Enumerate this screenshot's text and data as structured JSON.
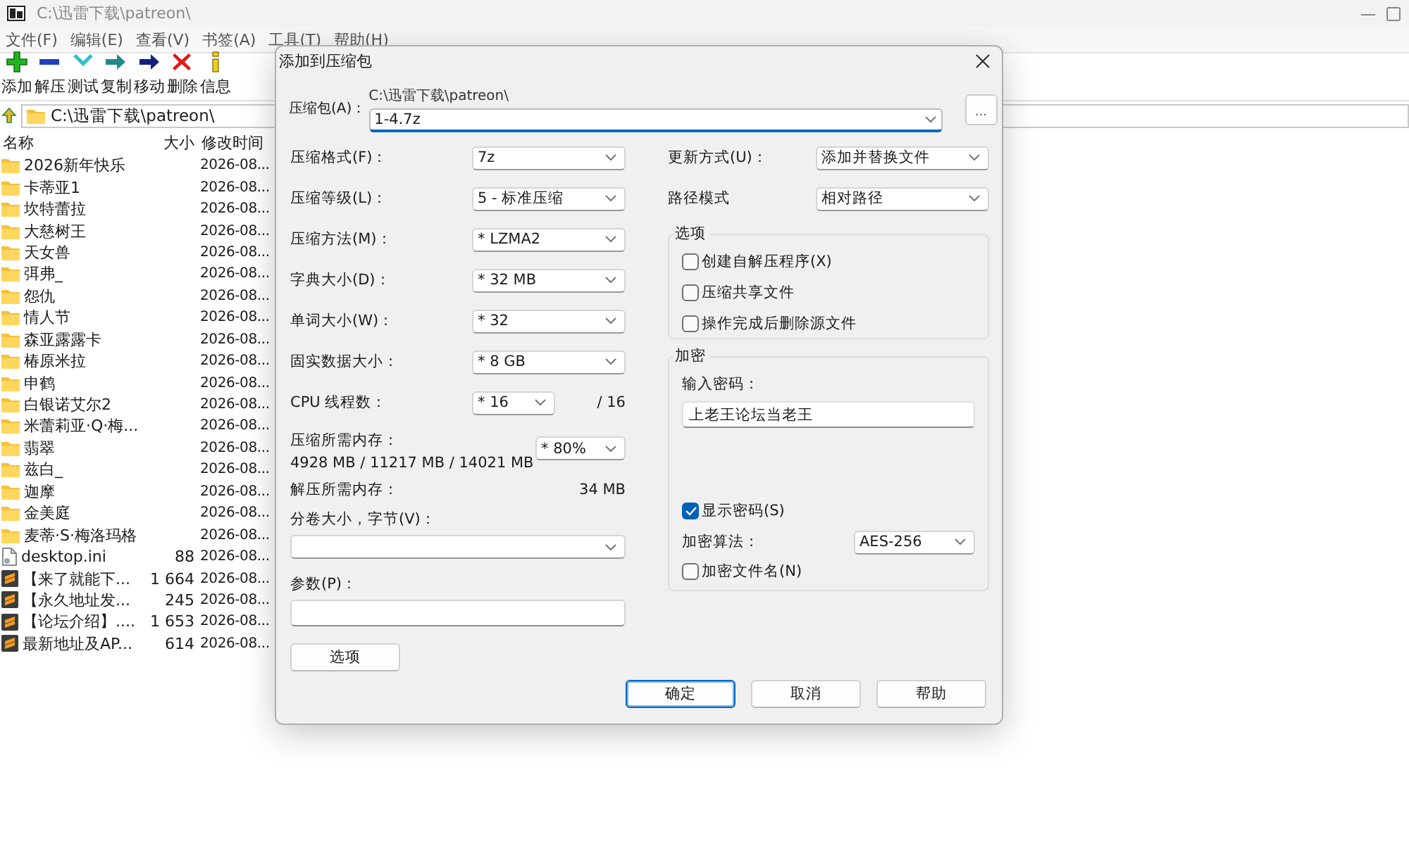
{
  "window": {
    "title": "C:\\迅雷下载\\patreon\\"
  },
  "menu": [
    {
      "label": "文件(F)"
    },
    {
      "label": "编辑(E)"
    },
    {
      "label": "查看(V)"
    },
    {
      "label": "书签(A)"
    },
    {
      "label": "工具(T)"
    },
    {
      "label": "帮助(H)"
    }
  ],
  "toolbar": [
    {
      "label": "添加",
      "kind": "add"
    },
    {
      "label": "解压",
      "kind": "extract"
    },
    {
      "label": "测试",
      "kind": "test"
    },
    {
      "label": "复制",
      "kind": "copy"
    },
    {
      "label": "移动",
      "kind": "move"
    },
    {
      "label": "删除",
      "kind": "delete"
    },
    {
      "label": "信息",
      "kind": "info"
    }
  ],
  "address": {
    "path": "C:\\迅雷下载\\patreon\\"
  },
  "file_list": {
    "columns": [
      "名称",
      "大小",
      "修改时间"
    ],
    "rows": [
      {
        "name": "2026新年快乐",
        "modified": "2026-08...",
        "kind": "folder"
      },
      {
        "name": "卡蒂亚1",
        "modified": "2026-08...",
        "kind": "folder"
      },
      {
        "name": "坎特蕾拉",
        "modified": "2026-08...",
        "kind": "folder"
      },
      {
        "name": "大慈树王",
        "modified": "2026-08...",
        "kind": "folder"
      },
      {
        "name": "天女兽",
        "modified": "2026-08...",
        "kind": "folder"
      },
      {
        "name": "弭弗_",
        "modified": "2026-08...",
        "kind": "folder"
      },
      {
        "name": "怨仇",
        "modified": "2026-08...",
        "kind": "folder"
      },
      {
        "name": "情人节",
        "modified": "2026-08...",
        "kind": "folder"
      },
      {
        "name": "森亚露露卡",
        "modified": "2026-08...",
        "kind": "folder"
      },
      {
        "name": "椿原米拉",
        "modified": "2026-08...",
        "kind": "folder"
      },
      {
        "name": "申鹤",
        "modified": "2026-08...",
        "kind": "folder"
      },
      {
        "name": "白银诺艾尔2",
        "modified": "2026-08...",
        "kind": "folder"
      },
      {
        "name": "米蕾莉亚·Q·梅...",
        "modified": "2026-08...",
        "kind": "folder"
      },
      {
        "name": "翡翠",
        "modified": "2026-08...",
        "kind": "folder"
      },
      {
        "name": "兹白_",
        "modified": "2026-08...",
        "kind": "folder"
      },
      {
        "name": "迦摩",
        "modified": "2026-08...",
        "kind": "folder"
      },
      {
        "name": "金美庭",
        "modified": "2026-08...",
        "kind": "folder"
      },
      {
        "name": "麦蒂·S·梅洛玛格",
        "modified": "2026-08...",
        "kind": "folder"
      },
      {
        "name": "desktop.ini",
        "size": "88",
        "modified": "2026-08...",
        "kind": "file"
      },
      {
        "name": "【来了就能下...",
        "size": "1 664",
        "modified": "2026-08...",
        "kind": "app"
      },
      {
        "name": "【永久地址发...",
        "size": "245",
        "modified": "2026-08...",
        "kind": "app"
      },
      {
        "name": "【论坛介绍】....",
        "size": "1 653",
        "modified": "2026-08...",
        "kind": "app"
      },
      {
        "name": "最新地址及AP...",
        "size": "614",
        "modified": "2026-08...",
        "kind": "app"
      }
    ]
  },
  "dialog": {
    "title": "添加到压缩包",
    "archive": {
      "label": "压缩包(A)：",
      "path": "C:\\迅雷下载\\patreon\\",
      "value": "1-4.7z"
    },
    "browse": "...",
    "left_fields": [
      {
        "label": "压缩格式(F)：",
        "value": "7z"
      },
      {
        "label": "压缩等级(L)：",
        "value": "5 - 标准压缩"
      },
      {
        "label": "压缩方法(M)：",
        "value": "* LZMA2"
      },
      {
        "label": "字典大小(D)：",
        "value": "* 32 MB"
      },
      {
        "label": "单词大小(W)：",
        "value": "* 32"
      },
      {
        "label": "固实数据大小：",
        "value": "* 8 GB"
      }
    ],
    "threads": {
      "label": "CPU 线程数：",
      "value": "* 16",
      "max": "/ 16"
    },
    "memory": {
      "label": "压缩所需内存：",
      "values": "4928 MB / 11217 MB / 14021 MB",
      "limit": "* 80%"
    },
    "decompress_memory": {
      "label": "解压所需内存：",
      "value": "34 MB"
    },
    "volume": {
      "label": "分卷大小，字节(V)："
    },
    "parameters": {
      "label": "参数(P)："
    },
    "options_button": "选项",
    "right_fields": [
      {
        "label": "更新方式(U)：",
        "value": "添加并替换文件"
      },
      {
        "label": "路径模式",
        "value": "相对路径"
      }
    ],
    "options_group": {
      "title": "选项",
      "checkboxes": [
        {
          "label": "创建自解压程序(X)",
          "checked": false
        },
        {
          "label": "压缩共享文件",
          "checked": false
        },
        {
          "label": "操作完成后删除源文件",
          "checked": false
        }
      ]
    },
    "encryption": {
      "title": "加密",
      "password_label": "输入密码：",
      "password": "上老王论坛当老王",
      "show_password": {
        "label": "显示密码(S)",
        "checked": true
      },
      "method_label": "加密算法：",
      "method": "AES-256",
      "encrypt_names": {
        "label": "加密文件名(N)",
        "checked": false
      }
    },
    "buttons": [
      {
        "label": "确定",
        "default": true
      },
      {
        "label": "取消",
        "default": false
      },
      {
        "label": "帮助",
        "default": false
      }
    ]
  }
}
